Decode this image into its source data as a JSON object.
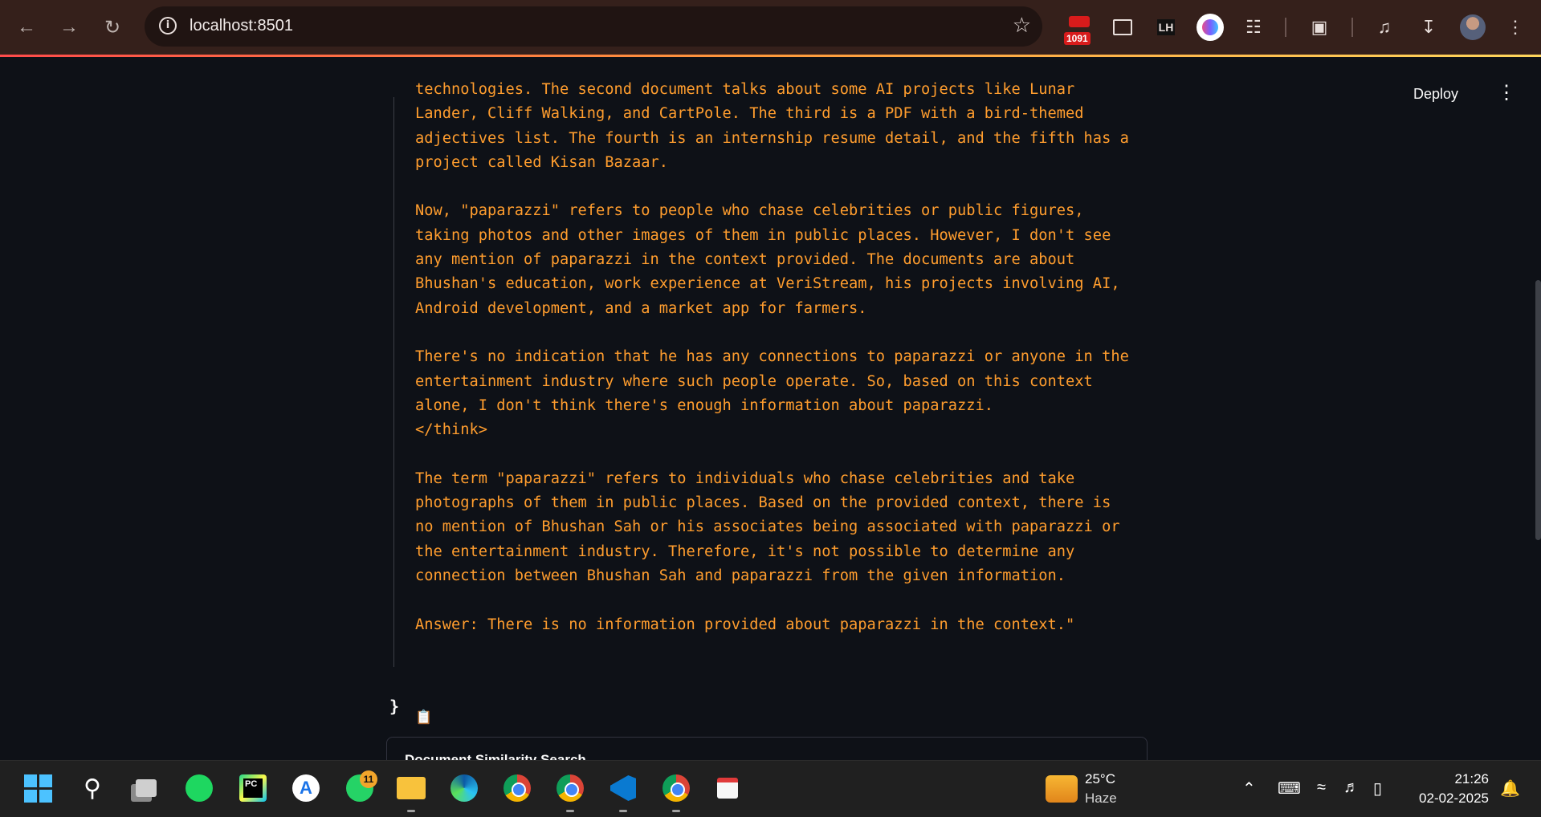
{
  "browser": {
    "url": "localhost:8501",
    "extension_badge": "1091",
    "extension_lh": "LH"
  },
  "app": {
    "deploy_label": "Deploy",
    "response_text": "technologies. The second document talks about some AI projects like Lunar\nLander, Cliff Walking, and CartPole. The third is a PDF with a bird-themed\nadjectives list. The fourth is an internship resume detail, and the fifth has a\nproject called Kisan Bazaar.\n\nNow, \"paparazzi\" refers to people who chase celebrities or public figures,\ntaking photos and other images of them in public places. However, I don't see\nany mention of paparazzi in the context provided. The documents are about\nBhushan's education, work experience at VeriStream, his projects involving AI,\nAndroid development, and a market app for farmers.\n\nThere's no indication that he has any connections to paparazzi or anyone in the\nentertainment industry where such people operate. So, based on this context\nalone, I don't think there's enough information about paparazzi.\n</think>\n\nThe term \"paparazzi\" refers to individuals who chase celebrities and take\nphotographs of them in public places. Based on the provided context, there is\nno mention of Bhushan Sah or his associates being associated with paparazzi or\nthe entertainment industry. Therefore, it's not possible to determine any\nconnection between Bhushan Sah and paparazzi from the given information.\n\nAnswer: There is no information provided about paparazzi in the context.\"",
    "closing_brace": "}",
    "expander_label": "Document Similarity Search",
    "text_color": "#ff9d2e",
    "background_color": "#0e1117"
  },
  "taskbar": {
    "whatsapp_badge": "11",
    "weather_temp": "25°C",
    "weather_desc": "Haze",
    "time": "21:26",
    "date": "02-02-2025",
    "pinned": [
      "windows-start",
      "search",
      "task-view",
      "spotify",
      "pycharm",
      "app-a",
      "whatsapp",
      "file-explorer",
      "edge",
      "chrome",
      "chrome-profile",
      "vscode",
      "chrome-profile-2",
      "snipping-tool"
    ]
  }
}
